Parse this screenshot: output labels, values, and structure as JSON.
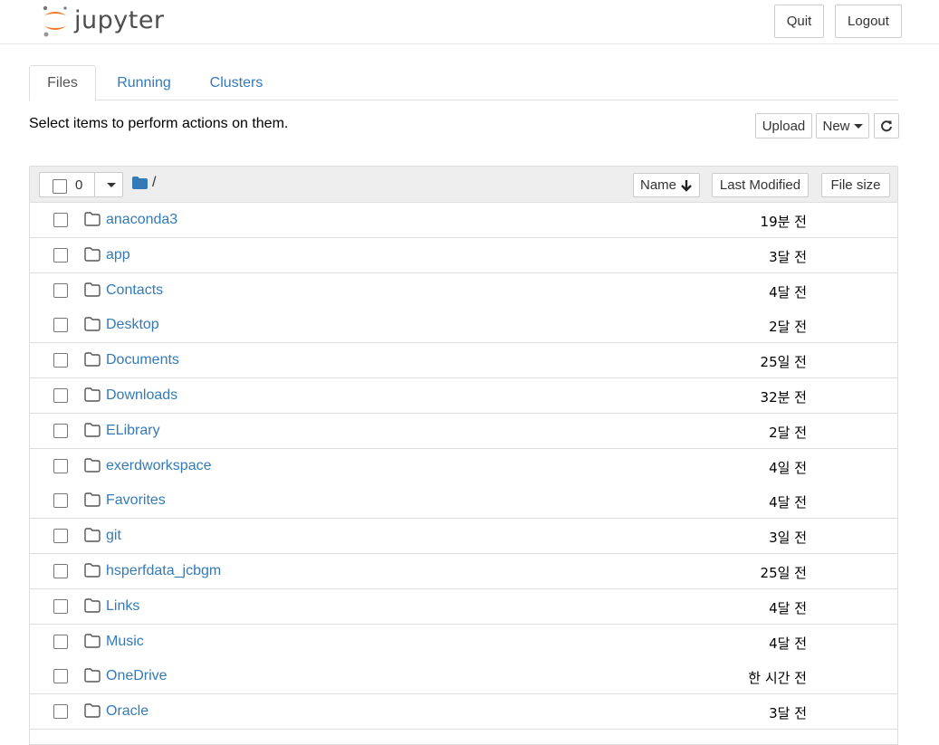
{
  "header": {
    "logo_text": "jupyter",
    "quit_label": "Quit",
    "logout_label": "Logout"
  },
  "tabs": [
    {
      "label": "Files",
      "active": true
    },
    {
      "label": "Running",
      "active": false
    },
    {
      "label": "Clusters",
      "active": false
    }
  ],
  "toolbar": {
    "hint": "Select items to perform actions on them.",
    "upload_label": "Upload",
    "new_label": "New",
    "refresh_icon": "refresh-icon"
  },
  "list_header": {
    "selected_count": "0",
    "path": "/",
    "sort_name_label": "Name",
    "sort_modified_label": "Last Modified",
    "sort_size_label": "File size"
  },
  "items": [
    {
      "name": "anaconda3",
      "modified": "19분 전",
      "type": "folder"
    },
    {
      "name": "app",
      "modified": "3달 전",
      "type": "folder"
    },
    {
      "name": "Contacts",
      "modified": "4달 전",
      "type": "folder"
    },
    {
      "name": "Desktop",
      "modified": "2달 전",
      "type": "folder"
    },
    {
      "name": "Documents",
      "modified": "25일 전",
      "type": "folder"
    },
    {
      "name": "Downloads",
      "modified": "32분 전",
      "type": "folder"
    },
    {
      "name": "ELibrary",
      "modified": "2달 전",
      "type": "folder"
    },
    {
      "name": "exerdworkspace",
      "modified": "4일 전",
      "type": "folder"
    },
    {
      "name": "Favorites",
      "modified": "4달 전",
      "type": "folder"
    },
    {
      "name": "git",
      "modified": "3일 전",
      "type": "folder"
    },
    {
      "name": "hsperfdata_jcbgm",
      "modified": "25일 전",
      "type": "folder"
    },
    {
      "name": "Links",
      "modified": "4달 전",
      "type": "folder"
    },
    {
      "name": "Music",
      "modified": "4달 전",
      "type": "folder"
    },
    {
      "name": "OneDrive",
      "modified": "한 시간 전",
      "type": "folder"
    },
    {
      "name": "Oracle",
      "modified": "3달 전",
      "type": "folder"
    }
  ],
  "colors": {
    "link": "#337ab7",
    "brand_orange": "#F37726",
    "header_bg": "#eeeeee"
  }
}
